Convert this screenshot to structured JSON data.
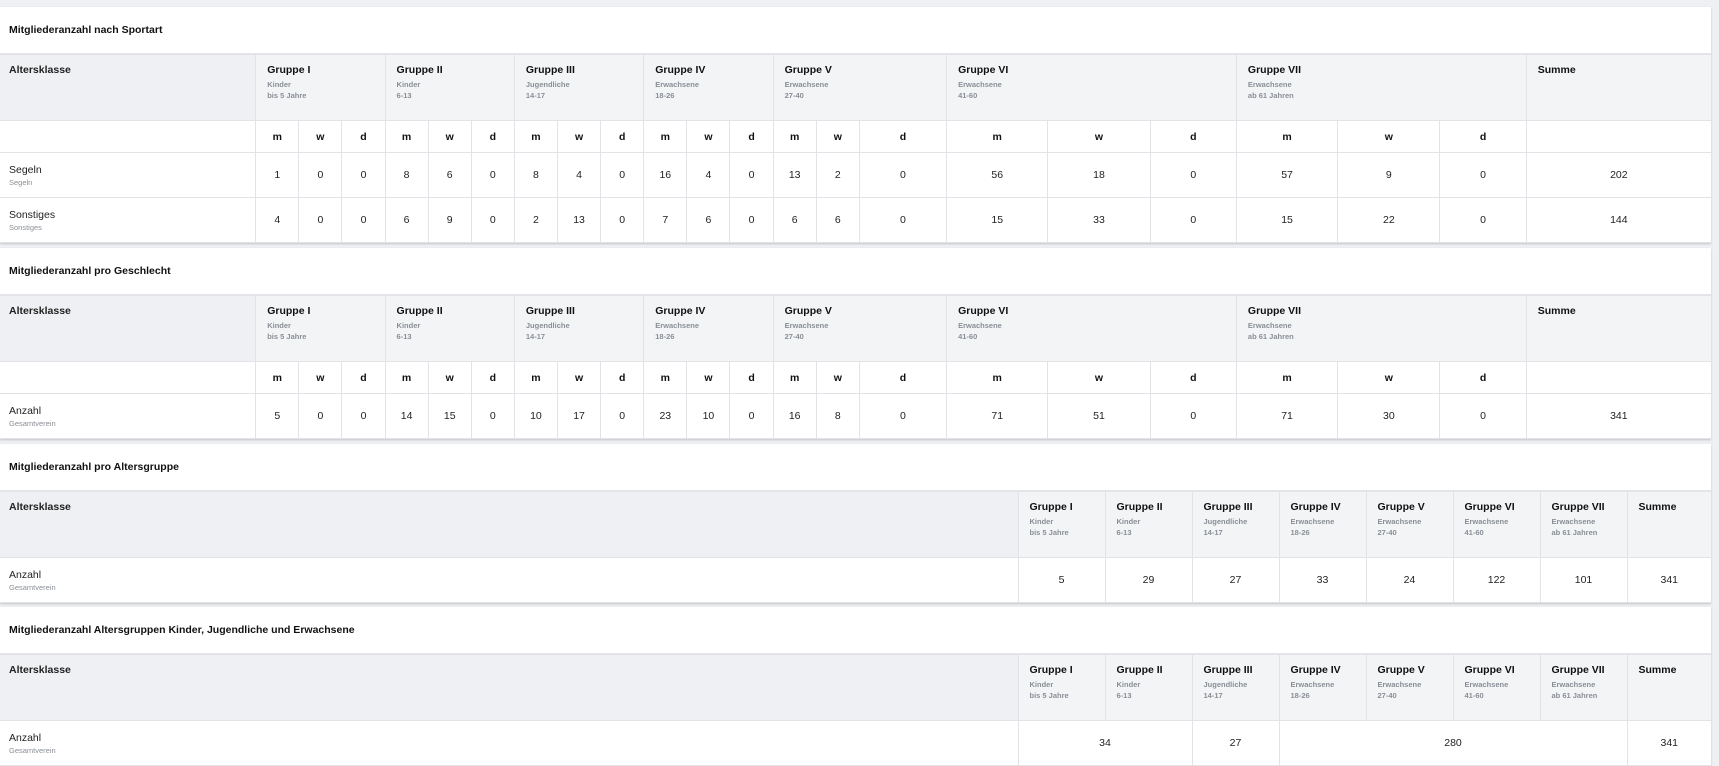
{
  "groups": [
    {
      "name": "Gruppe I",
      "sub1": "Kinder",
      "sub2": "bis 5 Jahre"
    },
    {
      "name": "Gruppe II",
      "sub1": "Kinder",
      "sub2": "6-13"
    },
    {
      "name": "Gruppe III",
      "sub1": "Jugendliche",
      "sub2": "14-17"
    },
    {
      "name": "Gruppe IV",
      "sub1": "Erwachsene",
      "sub2": "18-26"
    },
    {
      "name": "Gruppe V",
      "sub1": "Erwachsene",
      "sub2": "27-40"
    },
    {
      "name": "Gruppe VI",
      "sub1": "Erwachsene",
      "sub2": "41-60"
    },
    {
      "name": "Gruppe VII",
      "sub1": "Erwachsene",
      "sub2": "ab 61 Jahren"
    }
  ],
  "labels": {
    "altersklasse": "Altersklasse",
    "summe": "Summe",
    "m": "m",
    "w": "w",
    "d": "d"
  },
  "sections": {
    "sportart": {
      "title": "Mitgliederanzahl nach Sportart",
      "rows": [
        {
          "label": "Segeln",
          "sub": "Segeln",
          "values": [
            "1",
            "0",
            "0",
            "8",
            "6",
            "0",
            "8",
            "4",
            "0",
            "16",
            "4",
            "0",
            "13",
            "2",
            "0",
            "56",
            "18",
            "0",
            "57",
            "9",
            "0"
          ],
          "sum": "202"
        },
        {
          "label": "Sonstiges",
          "sub": "Sonstiges",
          "values": [
            "4",
            "0",
            "0",
            "6",
            "9",
            "0",
            "2",
            "13",
            "0",
            "7",
            "6",
            "0",
            "6",
            "6",
            "0",
            "15",
            "33",
            "0",
            "15",
            "22",
            "0"
          ],
          "sum": "144"
        }
      ]
    },
    "geschlecht": {
      "title": "Mitgliederanzahl pro Geschlecht",
      "rows": [
        {
          "label": "Anzahl",
          "sub": "Gesamtverein",
          "values": [
            "5",
            "0",
            "0",
            "14",
            "15",
            "0",
            "10",
            "17",
            "0",
            "23",
            "10",
            "0",
            "16",
            "8",
            "0",
            "71",
            "51",
            "0",
            "71",
            "30",
            "0"
          ],
          "sum": "341"
        }
      ]
    },
    "altersgruppe": {
      "title": "Mitgliederanzahl pro Altersgruppe",
      "row": {
        "label": "Anzahl",
        "sub": "Gesamtverein",
        "values": [
          "5",
          "29",
          "27",
          "33",
          "24",
          "122",
          "101"
        ],
        "sum": "341"
      }
    },
    "kje": {
      "title": "Mitgliederanzahl Altersgruppen Kinder, Jugendliche und Erwachsene",
      "row": {
        "label": "Anzahl",
        "sub": "Gesamtverein",
        "kinder": "34",
        "jugendliche": "27",
        "erwachsene": "280",
        "sum": "341"
      }
    }
  }
}
